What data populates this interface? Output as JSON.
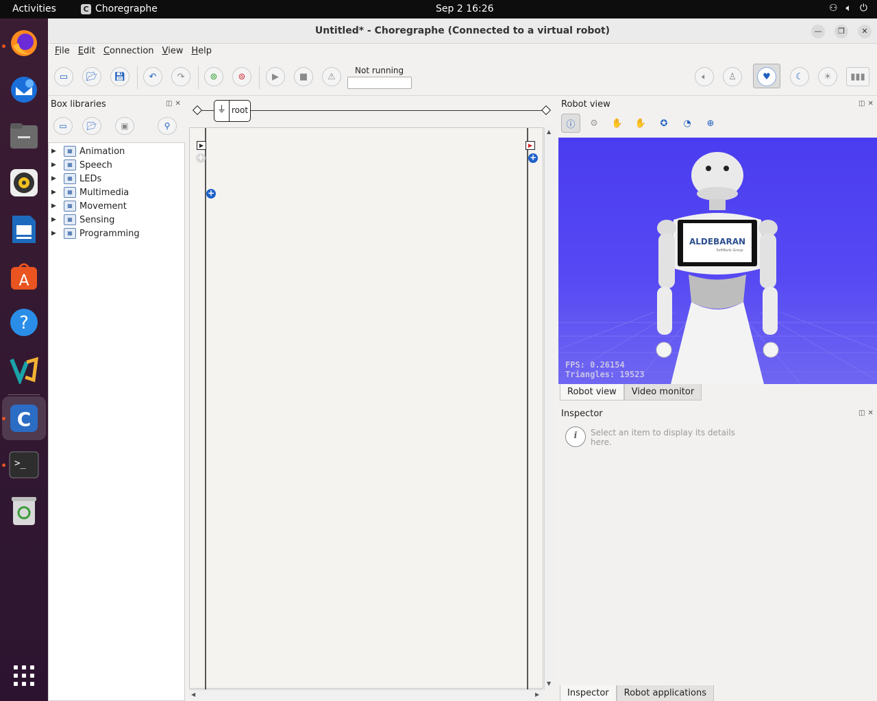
{
  "topbar": {
    "activities": "Activities",
    "app_name": "Choregraphe",
    "app_letter": "C",
    "clock": "Sep 2  16:26"
  },
  "window": {
    "title": "Untitled* - Choregraphe (Connected to a virtual robot)"
  },
  "menu": {
    "file": "File",
    "edit": "Edit",
    "connection": "Connection",
    "view": "View",
    "help": "Help"
  },
  "toolbar": {
    "status": "Not running"
  },
  "box_libraries": {
    "title": "Box libraries",
    "items": [
      {
        "label": "Animation"
      },
      {
        "label": "Speech"
      },
      {
        "label": "LEDs"
      },
      {
        "label": "Multimedia"
      },
      {
        "label": "Movement"
      },
      {
        "label": "Sensing"
      },
      {
        "label": "Programming"
      }
    ]
  },
  "diagram": {
    "root_label": "root"
  },
  "robot_view": {
    "title": "Robot view",
    "fps": "FPS: 0.26154",
    "triangles": "Triangles: 19523",
    "logo": "ALDEBARAN",
    "logo_sub": "SoftBank Group",
    "tabs": [
      "Robot view",
      "Video monitor"
    ]
  },
  "inspector": {
    "title": "Inspector",
    "message": "Select an item to display its details here.",
    "tabs": [
      "Inspector",
      "Robot applications"
    ]
  },
  "colors": {
    "accent": "#1f62c9",
    "view_bg": "#4a3df0",
    "dock_bg": "#3b1d33"
  }
}
